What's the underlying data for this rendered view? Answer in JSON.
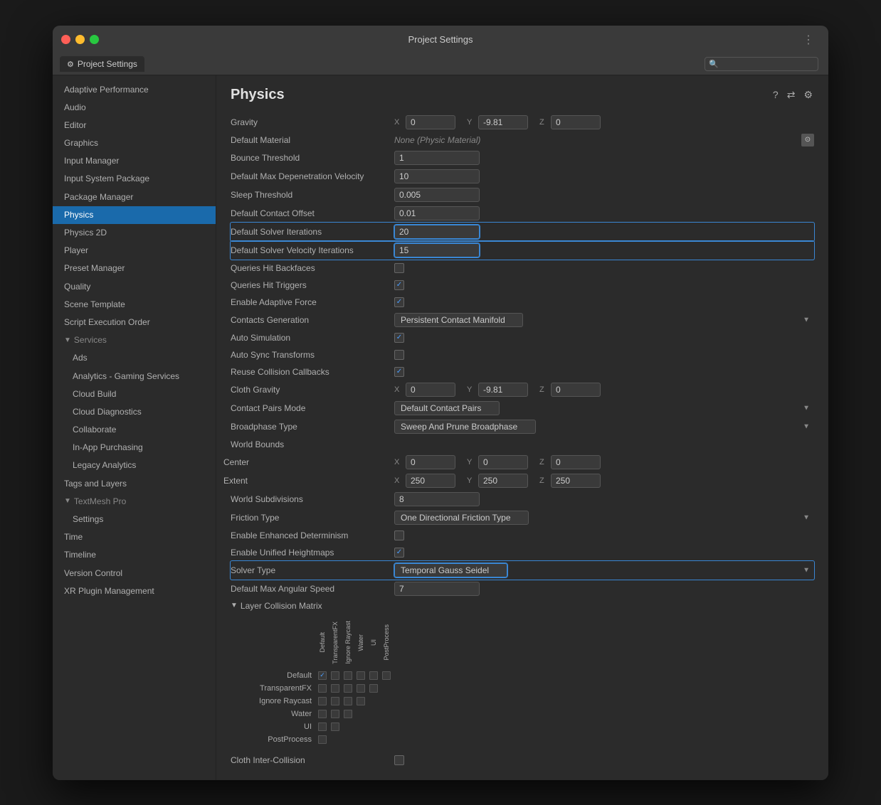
{
  "window": {
    "title": "Project Settings"
  },
  "tab": {
    "label": "Project Settings",
    "gear": "⚙"
  },
  "topbar": {
    "three_dots": "⋮"
  },
  "sidebar": {
    "items": [
      {
        "id": "adaptive-performance",
        "label": "Adaptive Performance",
        "sub": false,
        "active": false
      },
      {
        "id": "audio",
        "label": "Audio",
        "sub": false,
        "active": false
      },
      {
        "id": "editor",
        "label": "Editor",
        "sub": false,
        "active": false
      },
      {
        "id": "graphics",
        "label": "Graphics",
        "sub": false,
        "active": false
      },
      {
        "id": "input-manager",
        "label": "Input Manager",
        "sub": false,
        "active": false
      },
      {
        "id": "input-system-package",
        "label": "Input System Package",
        "sub": false,
        "active": false
      },
      {
        "id": "package-manager",
        "label": "Package Manager",
        "sub": false,
        "active": false
      },
      {
        "id": "physics",
        "label": "Physics",
        "sub": false,
        "active": true
      },
      {
        "id": "physics-2d",
        "label": "Physics 2D",
        "sub": false,
        "active": false
      },
      {
        "id": "player",
        "label": "Player",
        "sub": false,
        "active": false
      },
      {
        "id": "preset-manager",
        "label": "Preset Manager",
        "sub": false,
        "active": false
      },
      {
        "id": "quality",
        "label": "Quality",
        "sub": false,
        "active": false
      },
      {
        "id": "scene-template",
        "label": "Scene Template",
        "sub": false,
        "active": false
      },
      {
        "id": "script-execution-order",
        "label": "Script Execution Order",
        "sub": false,
        "active": false
      }
    ],
    "services_label": "Services",
    "services_items": [
      {
        "id": "ads",
        "label": "Ads"
      },
      {
        "id": "analytics-gaming",
        "label": "Analytics - Gaming Services"
      },
      {
        "id": "cloud-build",
        "label": "Cloud Build"
      },
      {
        "id": "cloud-diagnostics",
        "label": "Cloud Diagnostics"
      },
      {
        "id": "collaborate",
        "label": "Collaborate"
      },
      {
        "id": "in-app-purchasing",
        "label": "In-App Purchasing"
      },
      {
        "id": "legacy-analytics",
        "label": "Legacy Analytics"
      }
    ],
    "tags_layers": "Tags and Layers",
    "textmesh_pro": "TextMesh Pro",
    "textmesh_items": [
      {
        "id": "settings",
        "label": "Settings"
      }
    ],
    "time": "Time",
    "timeline": "Timeline",
    "version_control": "Version Control",
    "xr_plugin": "XR Plugin Management"
  },
  "content": {
    "title": "Physics",
    "settings": {
      "gravity_label": "Gravity",
      "gravity_x": "0",
      "gravity_y": "-9.81",
      "gravity_z": "0",
      "default_material_label": "Default Material",
      "default_material_value": "None (Physic Material)",
      "bounce_threshold_label": "Bounce Threshold",
      "bounce_threshold_value": "1",
      "default_max_depenetration_label": "Default Max Depenetration Velocity",
      "default_max_depenetration_value": "10",
      "sleep_threshold_label": "Sleep Threshold",
      "sleep_threshold_value": "0.005",
      "default_contact_offset_label": "Default Contact Offset",
      "default_contact_offset_value": "0.01",
      "default_solver_iterations_label": "Default Solver Iterations",
      "default_solver_iterations_value": "20",
      "default_solver_velocity_label": "Default Solver Velocity Iterations",
      "default_solver_velocity_value": "15",
      "queries_hit_backfaces_label": "Queries Hit Backfaces",
      "queries_hit_triggers_label": "Queries Hit Triggers",
      "enable_adaptive_force_label": "Enable Adaptive Force",
      "contacts_generation_label": "Contacts Generation",
      "contacts_generation_value": "Persistent Contact Manifold",
      "auto_simulation_label": "Auto Simulation",
      "auto_sync_transforms_label": "Auto Sync Transforms",
      "reuse_collision_callbacks_label": "Reuse Collision Callbacks",
      "cloth_gravity_label": "Cloth Gravity",
      "cloth_gravity_x": "0",
      "cloth_gravity_y": "-9.81",
      "cloth_gravity_z": "0",
      "contact_pairs_mode_label": "Contact Pairs Mode",
      "contact_pairs_mode_value": "Default Contact Pairs",
      "broadphase_type_label": "Broadphase Type",
      "broadphase_type_value": "Sweep And Prune Broadphase",
      "world_bounds_label": "World Bounds",
      "center_label": "Center",
      "center_x": "0",
      "center_y": "0",
      "center_z": "0",
      "extent_label": "Extent",
      "extent_x": "250",
      "extent_y": "250",
      "extent_z": "250",
      "world_subdivisions_label": "World Subdivisions",
      "world_subdivisions_value": "8",
      "friction_type_label": "Friction Type",
      "friction_type_value": "One Directional Friction Type",
      "enable_enhanced_determinism_label": "Enable Enhanced Determinism",
      "enable_unified_heightmaps_label": "Enable Unified Heightmaps",
      "solver_type_label": "Solver Type",
      "solver_type_value": "Temporal Gauss Seidel",
      "default_max_angular_speed_label": "Default Max Angular Speed",
      "default_max_angular_speed_value": "7",
      "layer_collision_matrix_label": "Layer Collision Matrix",
      "cloth_inter_collision_label": "Cloth Inter-Collision"
    },
    "matrix": {
      "col_labels": [
        "Default",
        "TransparentFX",
        "Ignore Raycast",
        "Water",
        "UI",
        "PostProcess"
      ],
      "rows": [
        {
          "label": "Default",
          "cells": [
            true,
            false,
            false,
            false,
            false,
            false
          ]
        },
        {
          "label": "TransparentFX",
          "cells": [
            false,
            false,
            false,
            false,
            false,
            false
          ]
        },
        {
          "label": "Ignore Raycast",
          "cells": [
            false,
            false,
            false,
            false,
            false,
            false
          ]
        },
        {
          "label": "Water",
          "cells": [
            false,
            false,
            false,
            false,
            false,
            false
          ]
        },
        {
          "label": "UI",
          "cells": [
            false,
            false,
            false,
            false,
            false,
            false
          ]
        },
        {
          "label": "PostProcess",
          "cells": [
            false,
            false,
            false,
            false,
            false,
            false
          ]
        }
      ]
    }
  }
}
